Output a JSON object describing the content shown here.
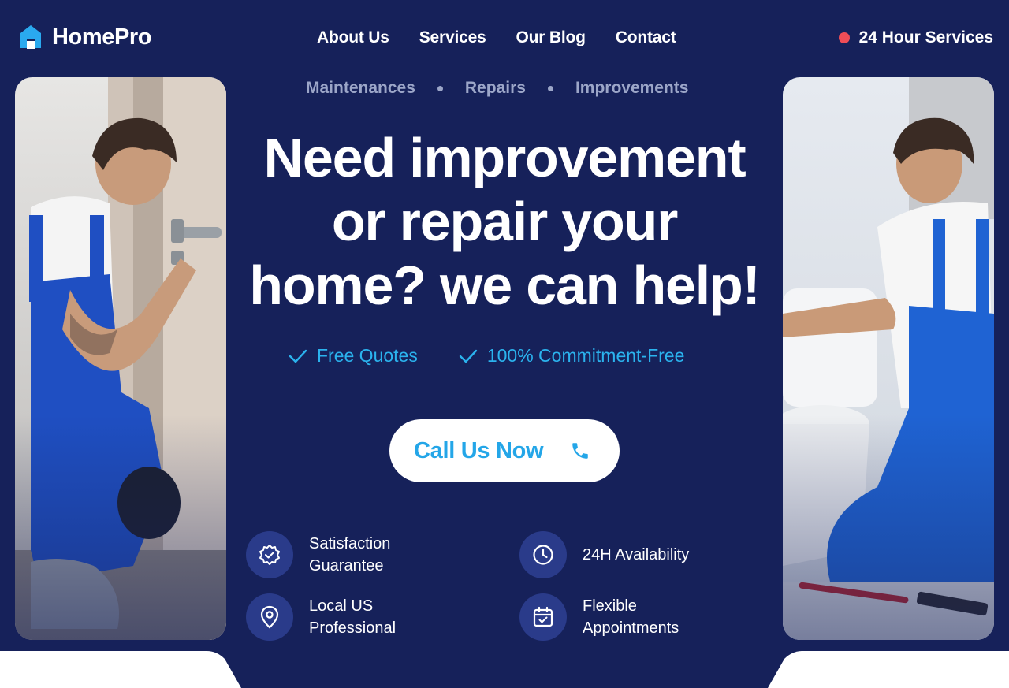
{
  "brand": {
    "name": "HomePro"
  },
  "nav": {
    "items": [
      "About Us",
      "Services",
      "Our Blog",
      "Contact"
    ]
  },
  "header": {
    "service_label": "24 Hour Services"
  },
  "hero": {
    "categories": [
      "Maintenances",
      "Repairs",
      "Improvements"
    ],
    "headline_lines": [
      "Need improvement",
      "or repair your",
      "home? we can help!"
    ],
    "checks": [
      "Free Quotes",
      "100% Commitment-Free"
    ],
    "cta_label": "Call Us Now"
  },
  "features": [
    {
      "icon": "badge-check-icon",
      "label": "Satisfaction Guarantee"
    },
    {
      "icon": "clock-icon",
      "label": "24H Availability"
    },
    {
      "icon": "location-pin-icon",
      "label": "Local US Professional"
    },
    {
      "icon": "calendar-check-icon",
      "label": "Flexible Appointments"
    }
  ],
  "colors": {
    "background": "#16215a",
    "accent": "#24a6e8",
    "live_dot": "#ef4d57",
    "muted_text": "#9ca6c8",
    "icon_circle": "#2a3b8a"
  }
}
